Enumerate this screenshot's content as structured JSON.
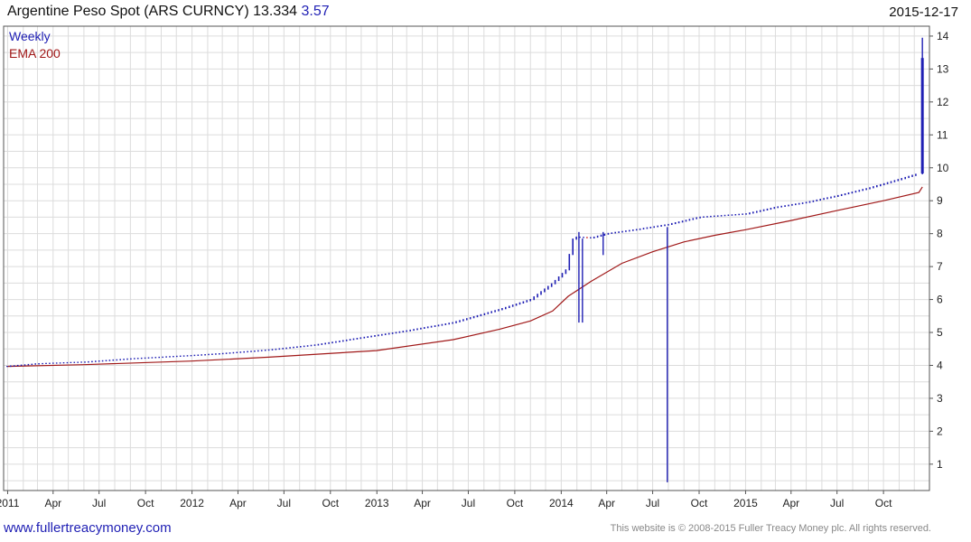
{
  "header": {
    "title": "Argentine Peso Spot (ARS CURNCY) 13.334",
    "change": "3.57",
    "date": "2015-12-17"
  },
  "footer": {
    "site": "www.fullertreacymoney.com",
    "copyright": "This website is © 2008-2015 Fuller Treacy Money plc. All rights reserved."
  },
  "colors": {
    "up_bar": "#1f1fb4",
    "down_bar": "#d02020",
    "ema_line": "#a01818",
    "grid": "#dcdcdc",
    "frame": "#555555"
  },
  "chart_data": {
    "type": "line",
    "title": "Argentine Peso Spot (ARS CURNCY) 13.334",
    "xlabel": "",
    "ylabel": "",
    "ylim": [
      0.2,
      14.3
    ],
    "yticks": [
      1,
      2,
      3,
      4,
      5,
      6,
      7,
      8,
      9,
      10,
      11,
      12,
      13,
      14
    ],
    "x_range": [
      "2010-12-24",
      "2015-12-31"
    ],
    "xticks": [
      {
        "label": "2011",
        "date": "2011-01-01"
      },
      {
        "label": "Apr",
        "date": "2011-04-01"
      },
      {
        "label": "Jul",
        "date": "2011-07-01"
      },
      {
        "label": "Oct",
        "date": "2011-10-01"
      },
      {
        "label": "2012",
        "date": "2012-01-01"
      },
      {
        "label": "Apr",
        "date": "2012-04-01"
      },
      {
        "label": "Jul",
        "date": "2012-07-01"
      },
      {
        "label": "Oct",
        "date": "2012-10-01"
      },
      {
        "label": "2013",
        "date": "2013-01-01"
      },
      {
        "label": "Apr",
        "date": "2013-04-01"
      },
      {
        "label": "Jul",
        "date": "2013-07-01"
      },
      {
        "label": "Oct",
        "date": "2013-10-01"
      },
      {
        "label": "2014",
        "date": "2014-01-01"
      },
      {
        "label": "Apr",
        "date": "2014-04-01"
      },
      {
        "label": "Jul",
        "date": "2014-07-01"
      },
      {
        "label": "Oct",
        "date": "2014-10-01"
      },
      {
        "label": "2015",
        "date": "2015-01-01"
      },
      {
        "label": "Apr",
        "date": "2015-04-01"
      },
      {
        "label": "Jul",
        "date": "2015-07-01"
      },
      {
        "label": "Oct",
        "date": "2015-10-01"
      }
    ],
    "grid": true,
    "legend": [
      "Weekly",
      "EMA 200"
    ],
    "legend_position": "top-left",
    "series": [
      {
        "name": "Weekly",
        "kind": "price",
        "points": [
          {
            "date": "2010-12-31",
            "value": 3.97
          },
          {
            "date": "2011-03-01",
            "value": 4.05
          },
          {
            "date": "2011-06-01",
            "value": 4.1
          },
          {
            "date": "2011-09-01",
            "value": 4.2
          },
          {
            "date": "2011-12-31",
            "value": 4.3
          },
          {
            "date": "2012-03-01",
            "value": 4.36
          },
          {
            "date": "2012-06-01",
            "value": 4.47
          },
          {
            "date": "2012-09-01",
            "value": 4.62
          },
          {
            "date": "2012-12-31",
            "value": 4.91
          },
          {
            "date": "2013-03-01",
            "value": 5.05
          },
          {
            "date": "2013-06-01",
            "value": 5.3
          },
          {
            "date": "2013-09-01",
            "value": 5.7
          },
          {
            "date": "2013-11-01",
            "value": 6.0
          },
          {
            "date": "2013-12-15",
            "value": 6.5
          },
          {
            "date": "2014-01-10",
            "value": 6.9
          },
          {
            "date": "2014-01-25",
            "value": 7.9
          },
          {
            "date": "2014-03-01",
            "value": 7.87
          },
          {
            "date": "2014-04-01",
            "value": 8.0
          },
          {
            "date": "2014-06-01",
            "value": 8.13
          },
          {
            "date": "2014-08-01",
            "value": 8.28
          },
          {
            "date": "2014-10-01",
            "value": 8.5
          },
          {
            "date": "2015-01-01",
            "value": 8.6
          },
          {
            "date": "2015-03-01",
            "value": 8.8
          },
          {
            "date": "2015-05-01",
            "value": 8.95
          },
          {
            "date": "2015-07-01",
            "value": 9.15
          },
          {
            "date": "2015-09-01",
            "value": 9.38
          },
          {
            "date": "2015-11-01",
            "value": 9.65
          },
          {
            "date": "2015-12-10",
            "value": 9.83
          },
          {
            "date": "2015-12-17",
            "value": 13.334
          }
        ],
        "spikes": [
          {
            "date": "2014-02-05",
            "low": 5.3,
            "high": 8.05
          },
          {
            "date": "2014-02-12",
            "low": 5.3,
            "high": 7.85
          },
          {
            "date": "2014-03-25",
            "low": 7.35,
            "high": 8.05
          },
          {
            "date": "2014-07-30",
            "low": 0.45,
            "high": 8.2
          },
          {
            "date": "2015-12-17",
            "low": 9.8,
            "high": 13.95
          }
        ]
      },
      {
        "name": "EMA 200",
        "kind": "line",
        "points": [
          {
            "date": "2010-12-31",
            "value": 3.97
          },
          {
            "date": "2011-06-01",
            "value": 4.02
          },
          {
            "date": "2011-12-31",
            "value": 4.13
          },
          {
            "date": "2012-06-01",
            "value": 4.25
          },
          {
            "date": "2012-12-31",
            "value": 4.45
          },
          {
            "date": "2013-06-01",
            "value": 4.78
          },
          {
            "date": "2013-09-01",
            "value": 5.1
          },
          {
            "date": "2013-11-01",
            "value": 5.35
          },
          {
            "date": "2013-12-15",
            "value": 5.65
          },
          {
            "date": "2014-01-15",
            "value": 6.1
          },
          {
            "date": "2014-03-01",
            "value": 6.55
          },
          {
            "date": "2014-05-01",
            "value": 7.1
          },
          {
            "date": "2014-07-01",
            "value": 7.45
          },
          {
            "date": "2014-09-01",
            "value": 7.75
          },
          {
            "date": "2014-11-01",
            "value": 7.95
          },
          {
            "date": "2015-01-01",
            "value": 8.12
          },
          {
            "date": "2015-04-01",
            "value": 8.4
          },
          {
            "date": "2015-07-01",
            "value": 8.7
          },
          {
            "date": "2015-10-01",
            "value": 9.0
          },
          {
            "date": "2015-12-10",
            "value": 9.25
          },
          {
            "date": "2015-12-17",
            "value": 9.42
          }
        ]
      }
    ]
  }
}
